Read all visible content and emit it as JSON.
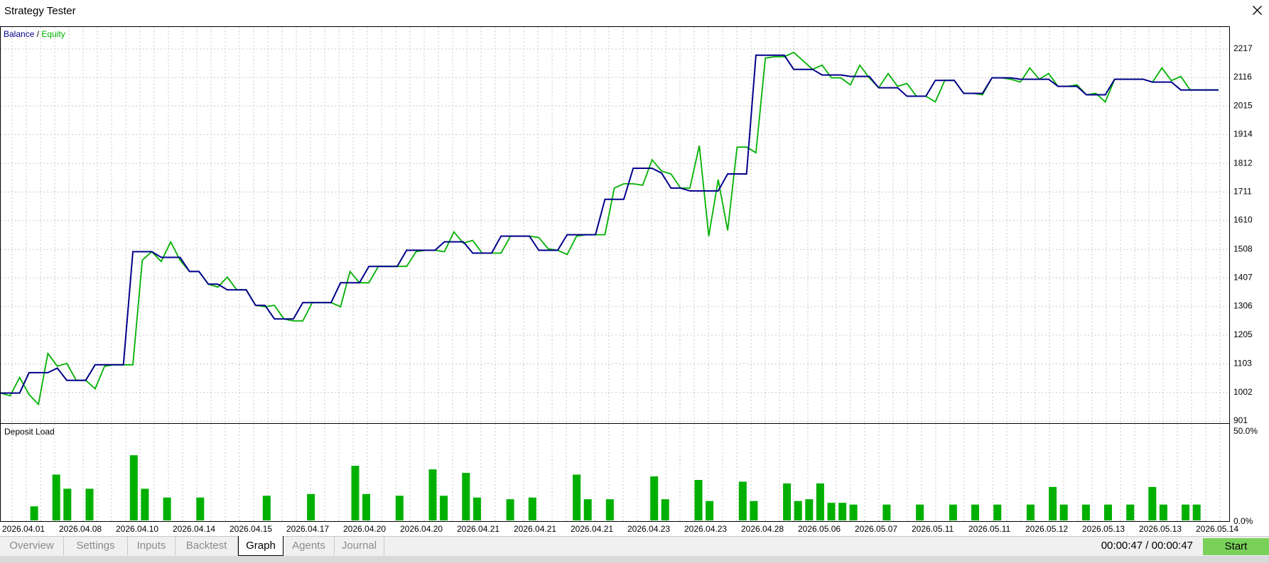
{
  "window": {
    "title": "Strategy Tester"
  },
  "legend": {
    "balance_label": "Balance",
    "separator": " / ",
    "equity_label": "Equity",
    "balance_color": "#00008b",
    "equity_color": "#00b000"
  },
  "deposit_panel": {
    "label": "Deposit Load",
    "top_label": "50.0%",
    "bottom_label": "0.0%"
  },
  "tabs": [
    {
      "label": "Overview",
      "active": false
    },
    {
      "label": "Settings",
      "active": false
    },
    {
      "label": "Inputs",
      "active": false
    },
    {
      "label": "Backtest",
      "active": false
    },
    {
      "label": "Graph",
      "active": true
    },
    {
      "label": "Agents",
      "active": false
    },
    {
      "label": "Journal",
      "active": false
    }
  ],
  "status": {
    "timer": "00:00:47 / 00:00:47",
    "start_label": "Start",
    "start_color": "#7ad15a"
  },
  "chart_data": {
    "type": "line",
    "y_ticks": [
      901,
      1002,
      1103,
      1205,
      1306,
      1407,
      1508,
      1610,
      1711,
      1812,
      1914,
      2015,
      2116,
      2217
    ],
    "x_tick_labels": [
      "2026.04.01",
      "2026.04.08",
      "2026.04.10",
      "2026.04.14",
      "2026.04.15",
      "2026.04.17",
      "2026.04.20",
      "2026.04.20",
      "2026.04.21",
      "2026.04.21",
      "2026.04.21",
      "2026.04.23",
      "2026.04.23",
      "2026.04.28",
      "2026.05.06",
      "2026.05.07",
      "2026.05.11",
      "2026.05.11",
      "2026.05.12",
      "2026.05.13",
      "2026.05.13",
      "2026.05.14"
    ],
    "series": [
      {
        "name": "Balance",
        "color": "#00008b",
        "points": [
          [
            0,
            1000
          ],
          [
            1,
            1000
          ],
          [
            2,
            1000
          ],
          [
            3,
            1072
          ],
          [
            4,
            1072
          ],
          [
            5,
            1072
          ],
          [
            6,
            1088
          ],
          [
            7,
            1045
          ],
          [
            8,
            1045
          ],
          [
            9,
            1045
          ],
          [
            10,
            1100
          ],
          [
            11,
            1100
          ],
          [
            12,
            1100
          ],
          [
            13,
            1100
          ],
          [
            14,
            1500
          ],
          [
            15,
            1500
          ],
          [
            16,
            1500
          ],
          [
            17,
            1480
          ],
          [
            18,
            1480
          ],
          [
            19,
            1480
          ],
          [
            20,
            1430
          ],
          [
            21,
            1430
          ],
          [
            22,
            1385
          ],
          [
            23,
            1385
          ],
          [
            24,
            1365
          ],
          [
            25,
            1365
          ],
          [
            26,
            1365
          ],
          [
            27,
            1310
          ],
          [
            28,
            1310
          ],
          [
            29,
            1262
          ],
          [
            30,
            1262
          ],
          [
            31,
            1262
          ],
          [
            32,
            1320
          ],
          [
            33,
            1320
          ],
          [
            34,
            1320
          ],
          [
            35,
            1320
          ],
          [
            36,
            1390
          ],
          [
            37,
            1390
          ],
          [
            38,
            1390
          ],
          [
            39,
            1448
          ],
          [
            40,
            1448
          ],
          [
            41,
            1448
          ],
          [
            42,
            1448
          ],
          [
            43,
            1505
          ],
          [
            44,
            1505
          ],
          [
            45,
            1505
          ],
          [
            46,
            1505
          ],
          [
            47,
            1535
          ],
          [
            48,
            1535
          ],
          [
            49,
            1535
          ],
          [
            50,
            1495
          ],
          [
            51,
            1495
          ],
          [
            52,
            1495
          ],
          [
            53,
            1555
          ],
          [
            54,
            1555
          ],
          [
            55,
            1555
          ],
          [
            56,
            1555
          ],
          [
            57,
            1505
          ],
          [
            58,
            1505
          ],
          [
            59,
            1505
          ],
          [
            60,
            1560
          ],
          [
            61,
            1560
          ],
          [
            62,
            1560
          ],
          [
            63,
            1560
          ],
          [
            64,
            1685
          ],
          [
            65,
            1685
          ],
          [
            66,
            1685
          ],
          [
            67,
            1795
          ],
          [
            68,
            1795
          ],
          [
            69,
            1795
          ],
          [
            70,
            1778
          ],
          [
            71,
            1725
          ],
          [
            72,
            1725
          ],
          [
            73,
            1715
          ],
          [
            74,
            1715
          ],
          [
            75,
            1715
          ],
          [
            76,
            1715
          ],
          [
            77,
            1775
          ],
          [
            78,
            1775
          ],
          [
            79,
            1775
          ],
          [
            80,
            2195
          ],
          [
            81,
            2195
          ],
          [
            82,
            2195
          ],
          [
            83,
            2195
          ],
          [
            84,
            2145
          ],
          [
            85,
            2145
          ],
          [
            86,
            2145
          ],
          [
            87,
            2125
          ],
          [
            88,
            2125
          ],
          [
            89,
            2125
          ],
          [
            90,
            2120
          ],
          [
            91,
            2120
          ],
          [
            92,
            2120
          ],
          [
            93,
            2080
          ],
          [
            94,
            2080
          ],
          [
            95,
            2080
          ],
          [
            96,
            2050
          ],
          [
            97,
            2050
          ],
          [
            98,
            2050
          ],
          [
            99,
            2106
          ],
          [
            100,
            2106
          ],
          [
            101,
            2106
          ],
          [
            102,
            2060
          ],
          [
            103,
            2060
          ],
          [
            104,
            2060
          ],
          [
            105,
            2115
          ],
          [
            106,
            2115
          ],
          [
            107,
            2115
          ],
          [
            108,
            2110
          ],
          [
            109,
            2110
          ],
          [
            110,
            2110
          ],
          [
            111,
            2110
          ],
          [
            112,
            2085
          ],
          [
            113,
            2085
          ],
          [
            114,
            2085
          ],
          [
            115,
            2055
          ],
          [
            116,
            2055
          ],
          [
            117,
            2055
          ],
          [
            118,
            2110
          ],
          [
            119,
            2110
          ],
          [
            120,
            2110
          ],
          [
            121,
            2110
          ],
          [
            122,
            2100
          ],
          [
            123,
            2100
          ],
          [
            124,
            2100
          ],
          [
            125,
            2072
          ],
          [
            126,
            2072
          ],
          [
            127,
            2072
          ],
          [
            128,
            2072
          ],
          [
            129,
            2072
          ]
        ]
      },
      {
        "name": "Equity",
        "color": "#00b000",
        "points": [
          [
            0,
            1000
          ],
          [
            1,
            990
          ],
          [
            2,
            1055
          ],
          [
            3,
            995
          ],
          [
            4,
            960
          ],
          [
            5,
            1140
          ],
          [
            6,
            1095
          ],
          [
            7,
            1105
          ],
          [
            8,
            1045
          ],
          [
            9,
            1045
          ],
          [
            10,
            1015
          ],
          [
            11,
            1095
          ],
          [
            12,
            1100
          ],
          [
            13,
            1100
          ],
          [
            14,
            1100
          ],
          [
            15,
            1470
          ],
          [
            16,
            1500
          ],
          [
            17,
            1465
          ],
          [
            18,
            1535
          ],
          [
            19,
            1470
          ],
          [
            20,
            1430
          ],
          [
            21,
            1430
          ],
          [
            22,
            1385
          ],
          [
            23,
            1375
          ],
          [
            24,
            1410
          ],
          [
            25,
            1365
          ],
          [
            26,
            1365
          ],
          [
            27,
            1310
          ],
          [
            28,
            1305
          ],
          [
            29,
            1310
          ],
          [
            30,
            1262
          ],
          [
            31,
            1255
          ],
          [
            32,
            1255
          ],
          [
            33,
            1320
          ],
          [
            34,
            1320
          ],
          [
            35,
            1320
          ],
          [
            36,
            1305
          ],
          [
            37,
            1430
          ],
          [
            38,
            1390
          ],
          [
            39,
            1390
          ],
          [
            40,
            1448
          ],
          [
            41,
            1448
          ],
          [
            42,
            1448
          ],
          [
            43,
            1448
          ],
          [
            44,
            1500
          ],
          [
            45,
            1505
          ],
          [
            46,
            1505
          ],
          [
            47,
            1500
          ],
          [
            48,
            1570
          ],
          [
            49,
            1530
          ],
          [
            50,
            1540
          ],
          [
            51,
            1495
          ],
          [
            52,
            1495
          ],
          [
            53,
            1495
          ],
          [
            54,
            1555
          ],
          [
            55,
            1555
          ],
          [
            56,
            1555
          ],
          [
            57,
            1550
          ],
          [
            58,
            1510
          ],
          [
            59,
            1505
          ],
          [
            60,
            1490
          ],
          [
            61,
            1555
          ],
          [
            62,
            1560
          ],
          [
            63,
            1560
          ],
          [
            64,
            1560
          ],
          [
            65,
            1725
          ],
          [
            66,
            1740
          ],
          [
            67,
            1740
          ],
          [
            68,
            1735
          ],
          [
            69,
            1825
          ],
          [
            70,
            1785
          ],
          [
            71,
            1775
          ],
          [
            72,
            1725
          ],
          [
            73,
            1725
          ],
          [
            74,
            1875
          ],
          [
            75,
            1555
          ],
          [
            76,
            1755
          ],
          [
            77,
            1575
          ],
          [
            78,
            1870
          ],
          [
            79,
            1870
          ],
          [
            80,
            1850
          ],
          [
            81,
            2185
          ],
          [
            82,
            2190
          ],
          [
            83,
            2190
          ],
          [
            84,
            2205
          ],
          [
            85,
            2175
          ],
          [
            86,
            2145
          ],
          [
            87,
            2160
          ],
          [
            88,
            2115
          ],
          [
            89,
            2115
          ],
          [
            90,
            2090
          ],
          [
            91,
            2160
          ],
          [
            92,
            2115
          ],
          [
            93,
            2080
          ],
          [
            94,
            2130
          ],
          [
            95,
            2085
          ],
          [
            96,
            2095
          ],
          [
            97,
            2050
          ],
          [
            98,
            2050
          ],
          [
            99,
            2030
          ],
          [
            100,
            2106
          ],
          [
            101,
            2106
          ],
          [
            102,
            2060
          ],
          [
            103,
            2060
          ],
          [
            104,
            2055
          ],
          [
            105,
            2115
          ],
          [
            106,
            2115
          ],
          [
            107,
            2110
          ],
          [
            108,
            2100
          ],
          [
            109,
            2150
          ],
          [
            110,
            2110
          ],
          [
            111,
            2130
          ],
          [
            112,
            2085
          ],
          [
            113,
            2085
          ],
          [
            114,
            2090
          ],
          [
            115,
            2055
          ],
          [
            116,
            2060
          ],
          [
            117,
            2030
          ],
          [
            118,
            2110
          ],
          [
            119,
            2110
          ],
          [
            120,
            2110
          ],
          [
            121,
            2110
          ],
          [
            122,
            2100
          ],
          [
            123,
            2150
          ],
          [
            124,
            2105
          ],
          [
            125,
            2120
          ],
          [
            126,
            2072
          ],
          [
            127,
            2072
          ],
          [
            128,
            2072
          ],
          [
            129,
            2072
          ]
        ]
      }
    ],
    "deposit_load": {
      "ylim": [
        0,
        50
      ],
      "unit": "%",
      "bars": [
        [
          1,
          8
        ],
        [
          3,
          26
        ],
        [
          4,
          18
        ],
        [
          6,
          18
        ],
        [
          10,
          37
        ],
        [
          11,
          18
        ],
        [
          13,
          13
        ],
        [
          16,
          13
        ],
        [
          22,
          14
        ],
        [
          26,
          15
        ],
        [
          30,
          31
        ],
        [
          31,
          15
        ],
        [
          34,
          14
        ],
        [
          37,
          29
        ],
        [
          38,
          14
        ],
        [
          40,
          27
        ],
        [
          41,
          13
        ],
        [
          44,
          12
        ],
        [
          46,
          13
        ],
        [
          50,
          26
        ],
        [
          51,
          12
        ],
        [
          53,
          12
        ],
        [
          57,
          25
        ],
        [
          58,
          12
        ],
        [
          61,
          23
        ],
        [
          62,
          11
        ],
        [
          65,
          22
        ],
        [
          66,
          11
        ],
        [
          69,
          21
        ],
        [
          70,
          11
        ],
        [
          71,
          12
        ],
        [
          72,
          21
        ],
        [
          73,
          10
        ],
        [
          74,
          10
        ],
        [
          75,
          9
        ],
        [
          78,
          9
        ],
        [
          81,
          9
        ],
        [
          84,
          9
        ],
        [
          86,
          9
        ],
        [
          88,
          9
        ],
        [
          91,
          9
        ],
        [
          93,
          19
        ],
        [
          94,
          9
        ],
        [
          96,
          9
        ],
        [
          98,
          9
        ],
        [
          100,
          9
        ],
        [
          102,
          19
        ],
        [
          103,
          9
        ],
        [
          105,
          9
        ],
        [
          106,
          9
        ]
      ]
    }
  }
}
